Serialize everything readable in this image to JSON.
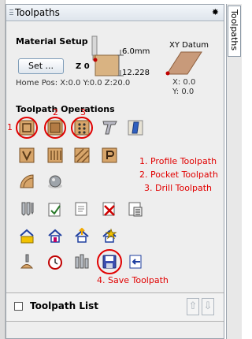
{
  "panel": {
    "title": "Toolpaths",
    "pin_glyph": "✸",
    "side_tab": "Toolpaths"
  },
  "material": {
    "heading": "Material Setup",
    "set_button": "Set ...",
    "z0_label": "Z 0",
    "thickness": "6.0mm",
    "depth": "12.228",
    "home_pos": "Home Pos:  X:0.0 Y:0.0 Z:20.0",
    "datum_label": "XY Datum",
    "datum_x": "X: 0.0",
    "datum_y": "Y: 0.0"
  },
  "operations": {
    "heading": "Toolpath Operations",
    "rows": [
      [
        "profile-toolpath-icon",
        "pocket-toolpath-icon",
        "drill-toolpath-icon",
        "text-engrave-icon",
        "inlay-toolpath-icon"
      ],
      [
        "v-carve-icon",
        "fluting-toolpath-icon",
        "texture-toolpath-icon",
        "prism-toolpath-icon"
      ],
      [
        "moulding-toolpath-icon",
        "3d-roughing-icon"
      ],
      [
        "tool-database-icon",
        "merge-toolpaths-icon",
        "edit-toolpath-icon",
        "delete-toolpath-icon",
        "calculate-toolpath-icon"
      ],
      [
        "folder-house-icon",
        "house-outline-icon",
        "house-up-icon",
        "house-star-icon"
      ],
      [
        "probe-icon",
        "time-estimate-icon",
        "bars-icon",
        "save-toolpath-icon",
        "import-toolpath-icon"
      ]
    ]
  },
  "annotations": {
    "markers": [
      "1",
      "2",
      "3"
    ],
    "profile": "1. Profile Toolpath",
    "pocket": "2. Pocket Toolpath",
    "drill": "3. Drill Toolpath",
    "save": "4. Save Toolpath"
  },
  "toolpath_list": {
    "label": "Toolpath List",
    "up": "⇧",
    "down": "⇩"
  }
}
